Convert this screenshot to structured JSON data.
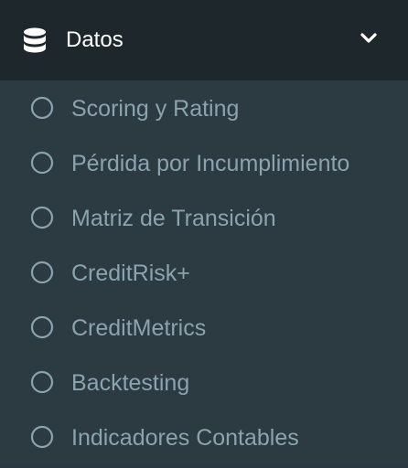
{
  "menu": {
    "header": {
      "icon": "database-icon",
      "label": "Datos",
      "chevron": "chevron-down-icon"
    },
    "items": [
      {
        "icon": "circle-outline-icon",
        "label": "Scoring y Rating"
      },
      {
        "icon": "circle-outline-icon",
        "label": "Pérdida por Incumplimiento"
      },
      {
        "icon": "circle-outline-icon",
        "label": "Matriz de Transición"
      },
      {
        "icon": "circle-outline-icon",
        "label": "CreditRisk+"
      },
      {
        "icon": "circle-outline-icon",
        "label": "CreditMetrics"
      },
      {
        "icon": "circle-outline-icon",
        "label": "Backtesting"
      },
      {
        "icon": "circle-outline-icon",
        "label": "Indicadores Contables"
      }
    ]
  },
  "colors": {
    "header_bg": "#1e282c",
    "submenu_bg": "#2c3b41",
    "header_text": "#ffffff",
    "item_text": "#8aa4af"
  }
}
